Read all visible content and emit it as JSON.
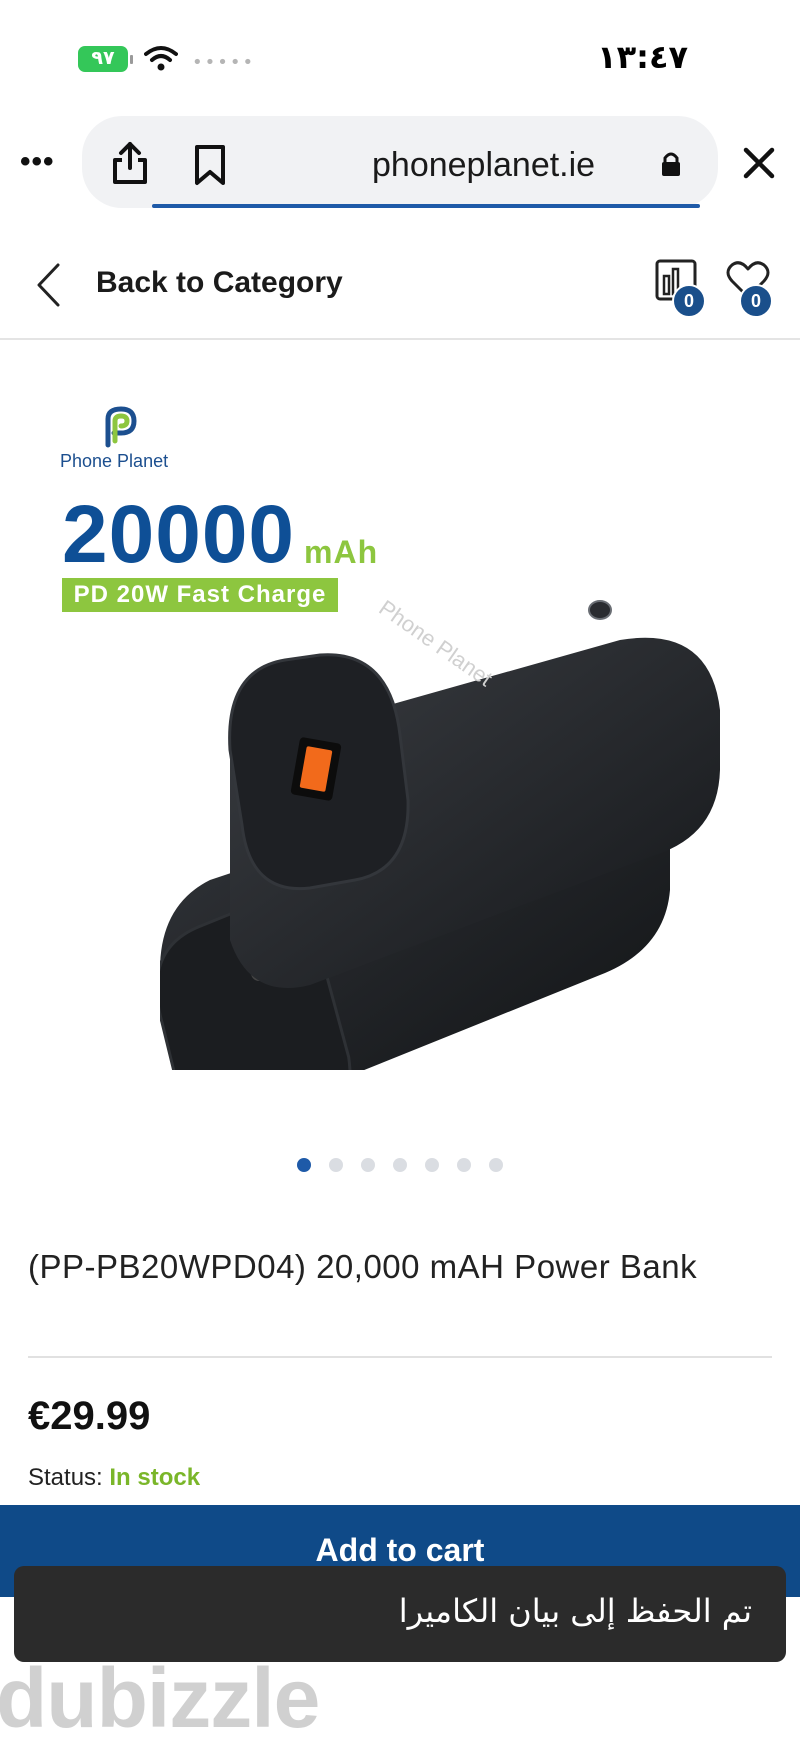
{
  "status_bar": {
    "time": "١٣:٤٧",
    "battery": "٩٧",
    "signal": "•••••"
  },
  "browser": {
    "url": "phoneplanet.ie",
    "more": "•••"
  },
  "header": {
    "back_label": "Back to Category",
    "compare_count": "0",
    "wishlist_count": "0"
  },
  "product_image": {
    "brand": "Phone Planet",
    "capacity": "20000",
    "capacity_unit": "mAh",
    "fast_charge": "PD 20W Fast Charge",
    "device_brand": "Phone Planet"
  },
  "carousel": {
    "count": 7,
    "active_index": 0
  },
  "product": {
    "title": "(PP-PB20WPD04) 20,000 mAH Power Bank",
    "price": "€29.99",
    "status_label": "Status:",
    "status_value": "In stock"
  },
  "cart": {
    "button_label": "Add to cart"
  },
  "toast": {
    "message": "تم الحفظ إلى بيان الكاميرا"
  },
  "watermark": {
    "text": "dubizzle"
  },
  "colors": {
    "brand_blue": "#0f4a88",
    "accent_green": "#8dc63f",
    "in_stock_green": "#7ab629",
    "battery_green": "#34c759"
  }
}
